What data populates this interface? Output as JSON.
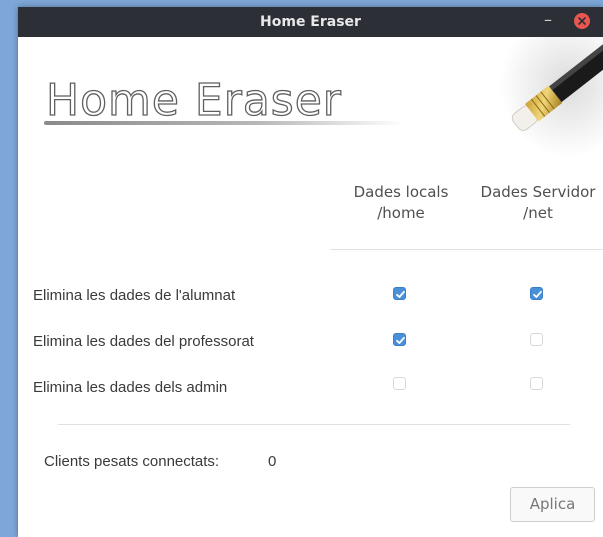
{
  "window": {
    "title": "Home Eraser"
  },
  "banner": {
    "logo_text": "Home Eraser"
  },
  "columns": [
    {
      "line1": "Dades locals",
      "line2": "/home"
    },
    {
      "line1": "Dades Servidor",
      "line2": "/net"
    }
  ],
  "rows": [
    {
      "label": "Elimina les dades de l'alumnat",
      "local_checked": true,
      "server_checked": true
    },
    {
      "label": "Elimina les dades del professorat",
      "local_checked": true,
      "server_checked": false
    },
    {
      "label": "Elimina les dades dels admin",
      "local_checked": false,
      "server_checked": false
    }
  ],
  "clients": {
    "label": "Clients pesats connectats:",
    "count": "0"
  },
  "apply_label": "Aplica",
  "colors": {
    "checkbox_accent": "#4a90d9",
    "titlebar": "#2c2f35",
    "close": "#e8564f"
  },
  "icons": {
    "minimize": "minimize-icon",
    "close": "close-icon",
    "check": "check-icon",
    "pencil": "pencil-eraser-icon"
  }
}
